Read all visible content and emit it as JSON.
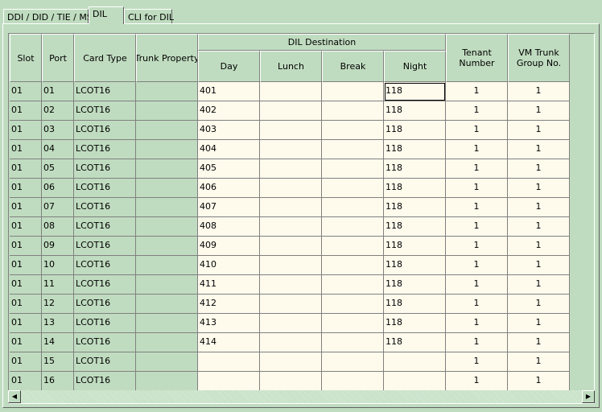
{
  "tabs": [
    "DDI / DID / TIE / MSN",
    "DIL",
    "CLI for DIL"
  ],
  "header": {
    "slot": "Slot",
    "port": "Port",
    "card_type": "Card Type",
    "trunk_property": "Trunk Property",
    "dil_destination": "DIL Destination",
    "day": "Day",
    "lunch": "Lunch",
    "break": "Break",
    "night": "Night",
    "tenant_number": "Tenant Number",
    "vm_trunk_group": "VM Trunk Group No."
  },
  "rows": [
    {
      "slot": "01",
      "port": "01",
      "card": "LCOT16",
      "day": "401",
      "night": "118",
      "tenant": "1",
      "vm": "1"
    },
    {
      "slot": "01",
      "port": "02",
      "card": "LCOT16",
      "day": "402",
      "night": "118",
      "tenant": "1",
      "vm": "1"
    },
    {
      "slot": "01",
      "port": "03",
      "card": "LCOT16",
      "day": "403",
      "night": "118",
      "tenant": "1",
      "vm": "1"
    },
    {
      "slot": "01",
      "port": "04",
      "card": "LCOT16",
      "day": "404",
      "night": "118",
      "tenant": "1",
      "vm": "1"
    },
    {
      "slot": "01",
      "port": "05",
      "card": "LCOT16",
      "day": "405",
      "night": "118",
      "tenant": "1",
      "vm": "1"
    },
    {
      "slot": "01",
      "port": "06",
      "card": "LCOT16",
      "day": "406",
      "night": "118",
      "tenant": "1",
      "vm": "1"
    },
    {
      "slot": "01",
      "port": "07",
      "card": "LCOT16",
      "day": "407",
      "night": "118",
      "tenant": "1",
      "vm": "1"
    },
    {
      "slot": "01",
      "port": "08",
      "card": "LCOT16",
      "day": "408",
      "night": "118",
      "tenant": "1",
      "vm": "1"
    },
    {
      "slot": "01",
      "port": "09",
      "card": "LCOT16",
      "day": "409",
      "night": "118",
      "tenant": "1",
      "vm": "1"
    },
    {
      "slot": "01",
      "port": "10",
      "card": "LCOT16",
      "day": "410",
      "night": "118",
      "tenant": "1",
      "vm": "1"
    },
    {
      "slot": "01",
      "port": "11",
      "card": "LCOT16",
      "day": "411",
      "night": "118",
      "tenant": "1",
      "vm": "1"
    },
    {
      "slot": "01",
      "port": "12",
      "card": "LCOT16",
      "day": "412",
      "night": "118",
      "tenant": "1",
      "vm": "1"
    },
    {
      "slot": "01",
      "port": "13",
      "card": "LCOT16",
      "day": "413",
      "night": "118",
      "tenant": "1",
      "vm": "1"
    },
    {
      "slot": "01",
      "port": "14",
      "card": "LCOT16",
      "day": "414",
      "night": "118",
      "tenant": "1",
      "vm": "1"
    },
    {
      "slot": "01",
      "port": "15",
      "card": "LCOT16",
      "day": "",
      "night": "",
      "tenant": "1",
      "vm": "1"
    },
    {
      "slot": "01",
      "port": "16",
      "card": "LCOT16",
      "day": "",
      "night": "",
      "tenant": "1",
      "vm": "1"
    }
  ],
  "scrollbar": {
    "left_arrow": "◀",
    "right_arrow": "▶"
  }
}
